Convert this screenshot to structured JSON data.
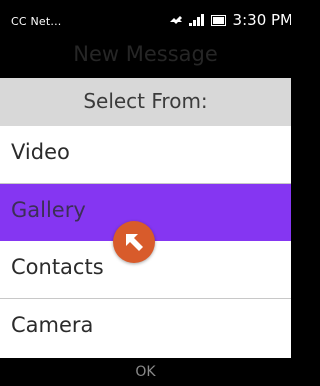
{
  "status_bar": {
    "carrier": "CC Net...",
    "time": "3:30 PM"
  },
  "header": {
    "title": "New Message"
  },
  "menu": {
    "heading": "Select From:",
    "items": [
      {
        "label": "Video"
      },
      {
        "label": "Gallery",
        "selected": true
      },
      {
        "label": "Contacts"
      },
      {
        "label": "Camera"
      }
    ]
  },
  "softkeys": {
    "center": "OK"
  },
  "colors": {
    "selected": "#8536f2",
    "cursor": "#d85b2b"
  },
  "icons": [
    "notification-icon",
    "signal-icon",
    "battery-icon",
    "arrow-cursor-icon"
  ]
}
